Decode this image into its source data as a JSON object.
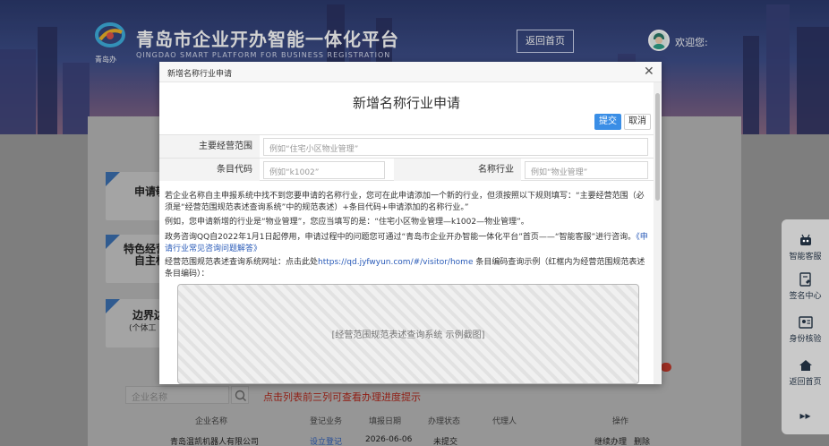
{
  "site": {
    "title": "青岛市企业开办智能一体化平台",
    "subtitle": "QINGDAO SMART PLATFORM FOR BUSINESS REGISTRATION",
    "logo_text": "青岛办",
    "back_home": "返回首页",
    "welcome": "欢迎您:"
  },
  "cards": [
    {
      "label": "申请敬"
    },
    {
      "label": "特色经营",
      "label2": "自主标"
    },
    {
      "label": "边界边",
      "sub": "(个体工"
    }
  ],
  "list": {
    "search_placeholder": "企业名称",
    "hint": "点击列表前三列可查看办理进度提示",
    "columns": [
      "企业名称",
      "登记业务",
      "填报日期",
      "办理状态",
      "代理人",
      "操作"
    ],
    "rows": [
      {
        "name": "青岛温凯机器人有限公司",
        "business": "设立登记",
        "date": "2026-06-06",
        "status": "未提交",
        "agent": "",
        "action_continue": "继续办理",
        "action_delete": "删除"
      }
    ]
  },
  "rail": {
    "items": [
      {
        "label": "智能客服",
        "icon": "robot-icon"
      },
      {
        "label": "签名中心",
        "icon": "signature-icon"
      },
      {
        "label": "身份核验",
        "icon": "id-verify-icon"
      },
      {
        "label": "返回首页",
        "icon": "home-icon"
      }
    ]
  },
  "modal": {
    "header_title": "新增名称行业申请",
    "form_title": "新增名称行业申请",
    "submit": "提交",
    "cancel": "取消",
    "fields": {
      "scope_label": "主要经营范围",
      "scope_placeholder": "例如“住宅小区物业管理”",
      "code_label": "条目代码",
      "code_placeholder": "例如“k1002”",
      "industry_label": "名称行业",
      "industry_placeholder": "例如“物业管理”"
    },
    "para1": "若企业名称自主申报系统中找不到您要申请的名称行业，您可在此申请添加一个新的行业，但须按照以下规则填写：“主要经营范围（必须是“经营范围规范表述查询系统”中的规范表述）+条目代码+申请添加的名称行业。”",
    "para2": "例如，您申请新增的行业是“物业管理”，您应当填写的是：“住宅小区物业管理—k1002—物业管理”。",
    "para3_a": "政务咨询QQ自2022年1月1日起停用，申请过程中的问题您可通过“青岛市企业开办智能一体化平台”首页——“智能客服”进行咨询。",
    "para3_b": "《申请行业常见咨询问题解答》",
    "para4_a": "经营范围规范表述查询系统网址：点击此处",
    "para4_link": "https://qd.jyfwyun.com/#/visitor/home",
    "para4_b": "条目编码查询示例（红框内为经营范围规范表述条目编码）：",
    "example_label": "[经营范围规范表述查询系统 示例截图]"
  }
}
